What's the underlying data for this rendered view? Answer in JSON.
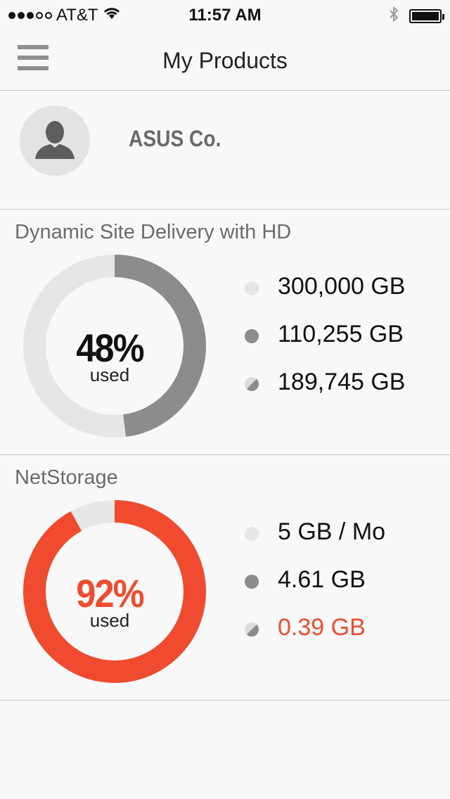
{
  "status_bar": {
    "carrier": "AT&T",
    "time": "11:57 AM",
    "signal_bars_filled": 3,
    "signal_bars_total": 5
  },
  "nav": {
    "title": "My Products",
    "menu_icon": "hamburger-menu-icon"
  },
  "account": {
    "name": "ASUS Co.",
    "avatar_icon": "user-avatar-icon"
  },
  "products": [
    {
      "title": "Dynamic Site Delivery with HD",
      "percent_label": "48%",
      "percent_value": 48,
      "used_label": "used",
      "accent_color": "#8c8c8c",
      "track_color": "#e6e6e6",
      "percent_color": "#111111",
      "legend": [
        {
          "text": "300,000 GB",
          "kind": "total"
        },
        {
          "text": "110,255 GB",
          "kind": "used"
        },
        {
          "text": "189,745 GB",
          "kind": "remaining"
        }
      ]
    },
    {
      "title": "NetStorage",
      "percent_label": "92%",
      "percent_value": 92,
      "used_label": "used",
      "accent_color": "#f04b2e",
      "track_color": "#e6e6e6",
      "percent_color": "#f04b2e",
      "legend": [
        {
          "text": "5 GB / Mo",
          "kind": "total"
        },
        {
          "text": "4.61 GB",
          "kind": "used"
        },
        {
          "text": "0.39 GB",
          "kind": "remaining",
          "color": "#f04b2e"
        }
      ]
    }
  ]
}
